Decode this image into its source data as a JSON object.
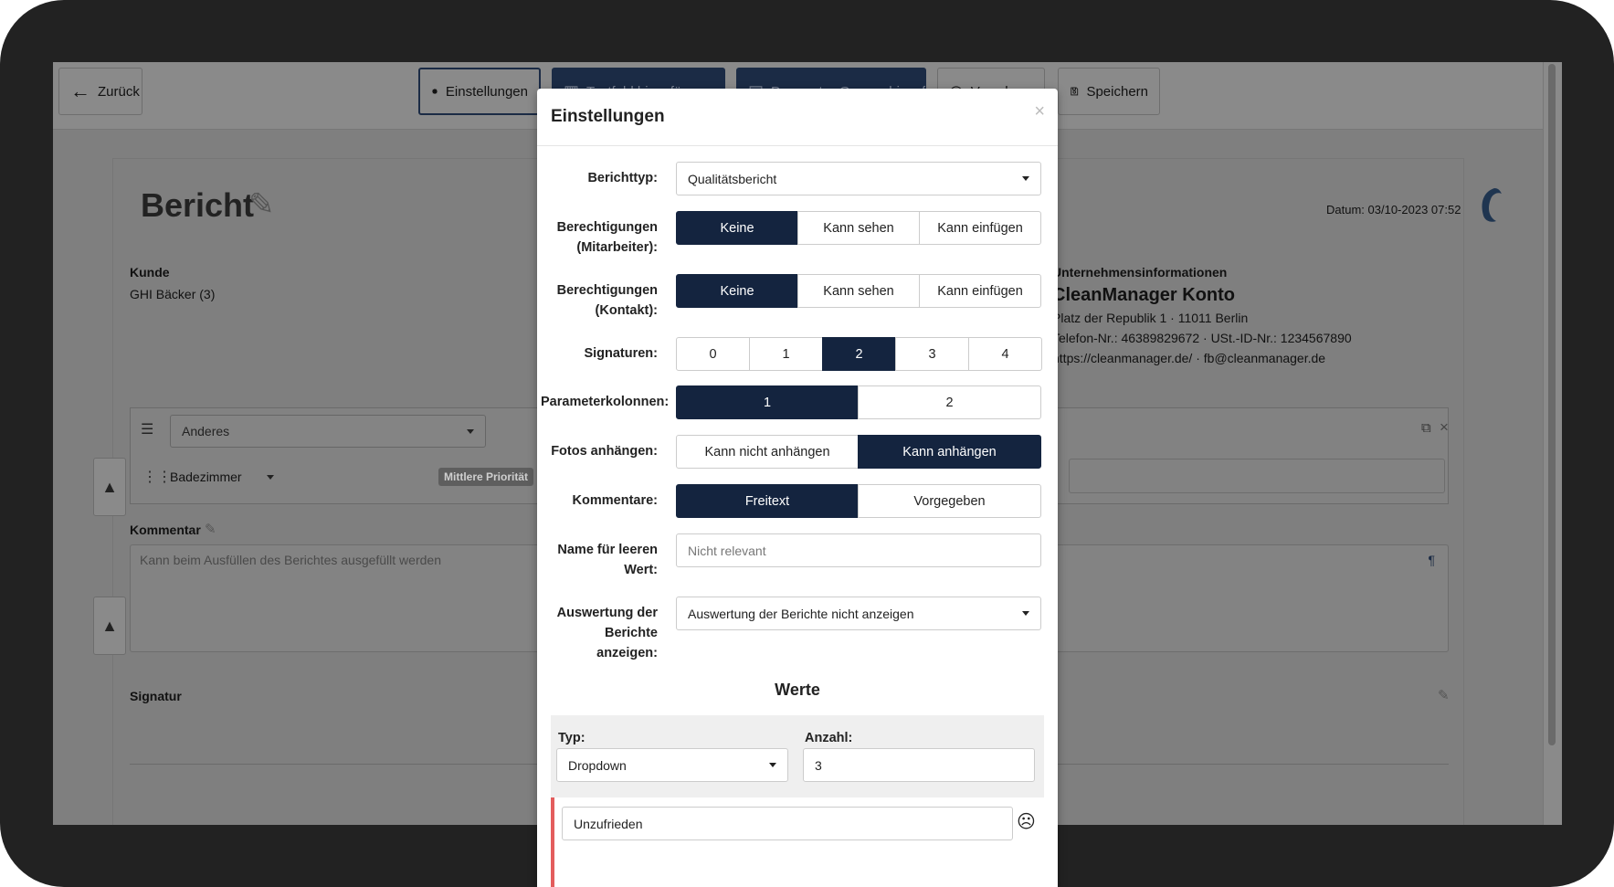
{
  "toolbar": {
    "back_label": "Zurück",
    "settings_label": "Einstellungen",
    "textfield_label": "Textfeld hinzufügen",
    "param_group_label": "Parameter-Gruppe hinzufügen",
    "preview_label": "Vorschau",
    "save_label": "Speichern"
  },
  "report": {
    "title": "Bericht",
    "date": "Datum: 03/10-2023 07:52",
    "customer_label": "Kunde",
    "customer_value": "GHI Bäcker (3)",
    "company_info_label": "Unternehmensinformationen",
    "company_name": "CleanManager Konto",
    "company_address": "Platz der Republik 1 · 11011 Berlin",
    "company_tax": "Telefon-Nr.: 46389829672 · USt.-ID-Nr.: 1234567890",
    "company_web": "https://cleanmanager.de/ · fb@cleanmanager.de",
    "section_select": "Anderes",
    "item_select": "Badezimmer",
    "priority_badge": "Mittlere Priorität",
    "comment_label": "Kommentar",
    "comment_placeholder": "Kann beim Ausfüllen des Berichtes ausgefüllt werden",
    "signature_label": "Signatur"
  },
  "modal": {
    "title": "Einstellungen",
    "close": "×",
    "berichttyp_label": "Berichttyp:",
    "berichttyp_value": "Qualitätsbericht",
    "perm_employee_label": "Berechtigungen (Mitarbeiter):",
    "perm_employee_options": [
      "Keine",
      "Kann sehen",
      "Kann einfügen"
    ],
    "perm_contact_label": "Berechtigungen (Kontakt):",
    "perm_contact_options": [
      "Keine",
      "Kann sehen",
      "Kann einfügen"
    ],
    "signatures_label": "Signaturen:",
    "signatures_options": [
      "0",
      "1",
      "2",
      "3",
      "4"
    ],
    "param_columns_label": "Parameterkolonnen:",
    "param_columns_options": [
      "1",
      "2"
    ],
    "photos_label": "Fotos anhängen:",
    "photos_options": [
      "Kann nicht anhängen",
      "Kann anhängen"
    ],
    "comments_label": "Kommentare:",
    "comments_options": [
      "Freitext",
      "Vorgegeben"
    ],
    "empty_name_label": "Name für leeren Wert:",
    "empty_name_value": "Nicht relevant",
    "evaluation_label": "Auswertung der Berichte anzeigen:",
    "evaluation_value": "Auswertung der Berichte nicht anzeigen",
    "werte_title": "Werte",
    "typ_label": "Typ:",
    "typ_value": "Dropdown",
    "anzahl_label": "Anzahl:",
    "anzahl_value": "3",
    "first_value": "Unzufrieden"
  },
  "colors": {
    "active": "#14243f",
    "arrow": "#1b2b45",
    "overlay": "#7f7f7f"
  }
}
